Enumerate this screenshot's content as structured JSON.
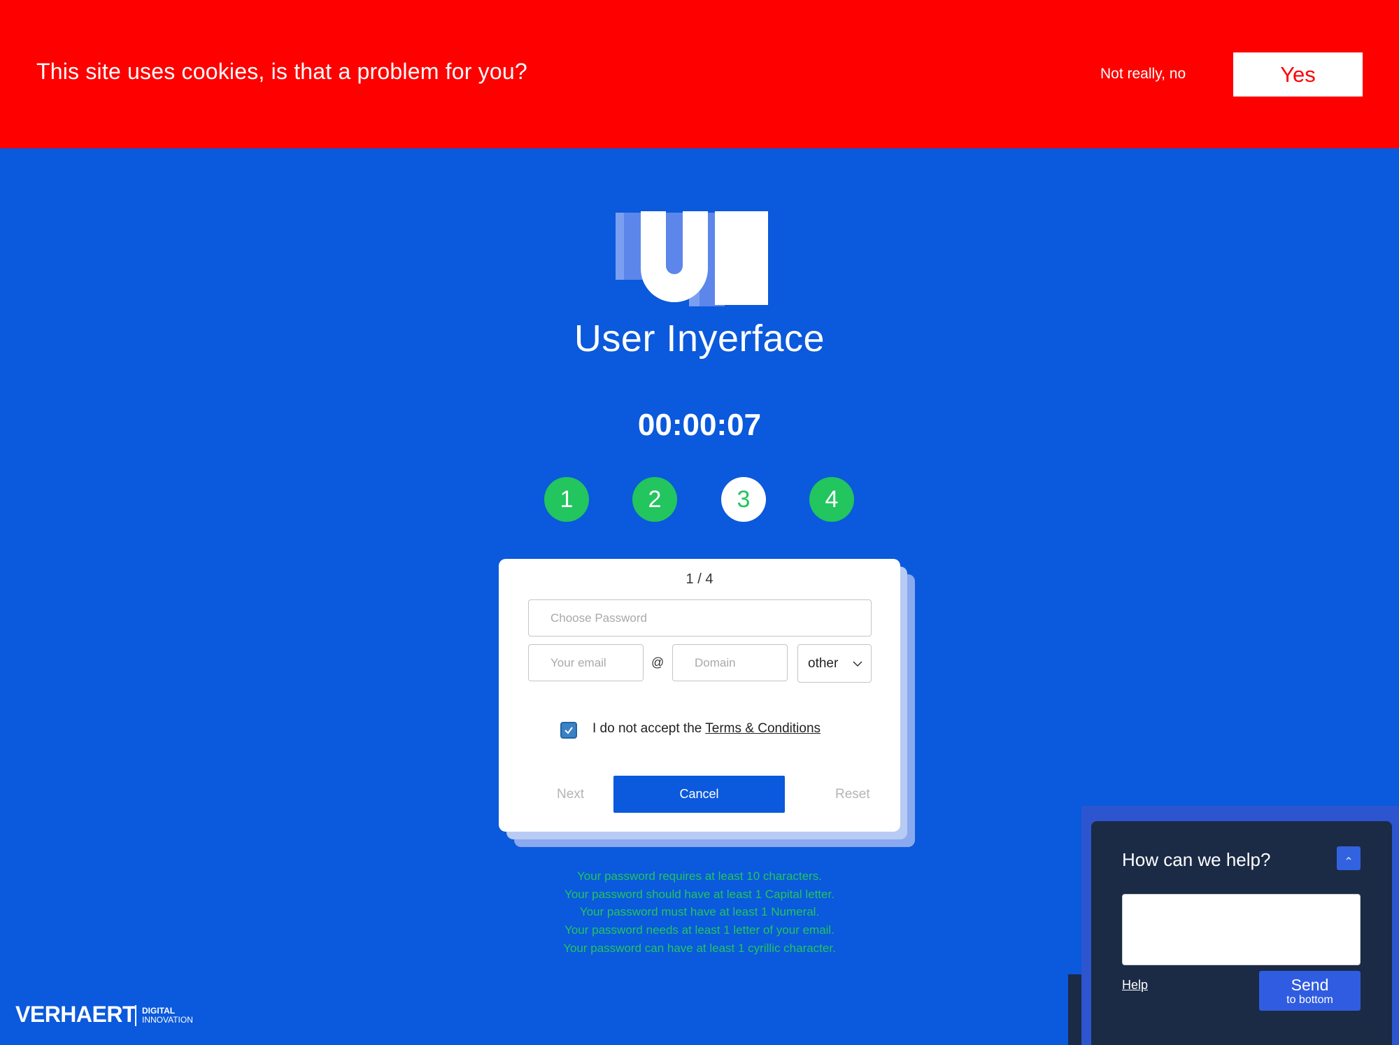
{
  "cookie_banner": {
    "message": "This site uses cookies, is that a problem for you?",
    "decline_label": "Not really, no",
    "accept_label": "Yes"
  },
  "brand": {
    "logo_text": "UI",
    "name": "User Inyerface"
  },
  "timer": "00:00:07",
  "steps": [
    {
      "label": "1",
      "active": false
    },
    {
      "label": "2",
      "active": false
    },
    {
      "label": "3",
      "active": true
    },
    {
      "label": "4",
      "active": false
    }
  ],
  "form": {
    "page_counter": "1 / 4",
    "password_placeholder": "Choose Password",
    "email_placeholder": "Your email",
    "at_symbol": "@",
    "domain_placeholder": "Domain",
    "tld_selected": "other",
    "terms_checked": true,
    "terms_prefix": "I do not accept the ",
    "terms_link": "Terms & Conditions",
    "next_label": "Next",
    "cancel_label": "Cancel",
    "reset_label": "Reset"
  },
  "password_rules": [
    "Your password requires at least 10 characters.",
    "Your password should have at least 1 Capital letter.",
    "Your password must have at least 1 Numeral.",
    "Your password needs at least 1 letter of your email.",
    "Your password can have at least 1 cyrillic character."
  ],
  "footer_brand": {
    "name": "VERHAERT",
    "sub_line1": "DIGITAL",
    "sub_line2": "INNOVATION"
  },
  "help_widget": {
    "title": "How can we help?",
    "help_link": "Help",
    "send_label": "Send",
    "send_sub": "to bottom"
  },
  "colors": {
    "background": "#0b59dc",
    "cookie_banner": "#ff0000",
    "step_green": "#22c55e",
    "rules_text": "#22c55e",
    "help_panel": "#1b2a45"
  },
  "icons": {
    "tld_dropdown": "chevron-down-icon",
    "checkbox": "check-icon",
    "help_collapse": "chevron-up-icon"
  }
}
